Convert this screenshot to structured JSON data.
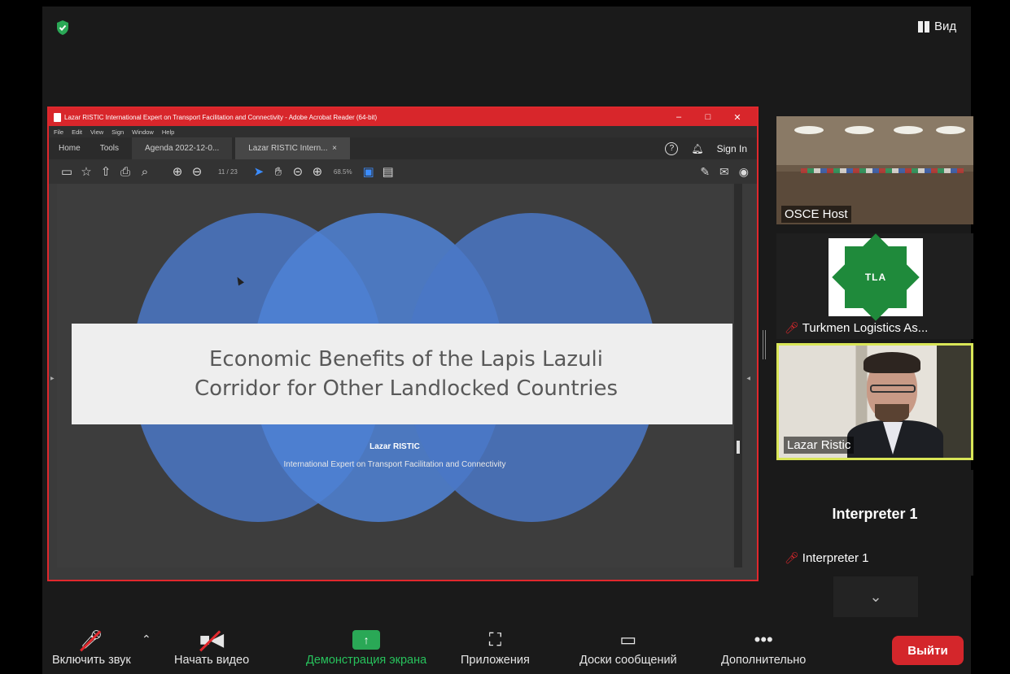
{
  "top": {
    "view_label": "Вид"
  },
  "acrobat": {
    "title": "Lazar RISTIC International Expert on Transport Facilitation and Connectivity - Adobe Acrobat Reader (64-bit)",
    "menu": [
      "File",
      "Edit",
      "View",
      "Sign",
      "Window",
      "Help"
    ],
    "tabs": {
      "home": "Home",
      "tools": "Tools",
      "doc1": "Agenda 2022-12-0...",
      "doc2": "Lazar RISTIC Intern..."
    },
    "sign_in": "Sign In",
    "page_indicator": "11 / 23",
    "zoom": "68.5%"
  },
  "slide": {
    "title_line1": "Economic Benefits of the Lapis Lazuli",
    "title_line2": "Corridor for Other Landlocked Countries",
    "author": "Lazar RISTIC",
    "author_title": "International Expert on Transport Facilitation and Connectivity"
  },
  "participants": [
    {
      "name": "OSCE Host"
    },
    {
      "name": "Turkmen Logistics As...",
      "logo_text": "TLA"
    },
    {
      "name": "Lazar Ristic"
    },
    {
      "name": "Interpreter 1",
      "display_name": "Interpreter 1"
    }
  ],
  "toolbar": {
    "mute": "Включить звук",
    "video": "Начать видео",
    "share": "Демонстрация экрана",
    "apps": "Приложения",
    "whiteboards": "Доски сообщений",
    "more": "Дополнительно",
    "leave": "Выйти"
  },
  "colors": {
    "accent_green": "#27c25c",
    "leave_red": "#d4262b",
    "active_speaker": "#d9e657"
  }
}
